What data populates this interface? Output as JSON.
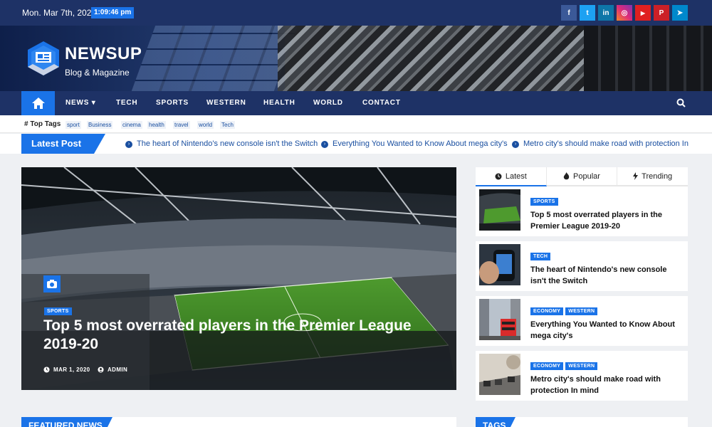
{
  "topbar": {
    "date": "Mon. Mar 7th, 2022",
    "time": "1:09:46 pm",
    "social": [
      {
        "name": "facebook-icon",
        "glyph": "f",
        "color": "#3b5998"
      },
      {
        "name": "twitter-icon",
        "glyph": "t",
        "color": "#1da1f2"
      },
      {
        "name": "linkedin-icon",
        "glyph": "in",
        "color": "#0e76a8"
      },
      {
        "name": "instagram-icon",
        "glyph": "◎",
        "color": "#c13584"
      },
      {
        "name": "youtube-icon",
        "glyph": "▶",
        "color": "#e02020"
      },
      {
        "name": "pinterest-icon",
        "glyph": "P",
        "color": "#cb2027"
      },
      {
        "name": "telegram-icon",
        "glyph": "➤",
        "color": "#0088cc"
      }
    ]
  },
  "header": {
    "brand": "NEWSUP",
    "tagline": "Blog & Magazine"
  },
  "nav": {
    "items": [
      "NEWS",
      "TECH",
      "SPORTS",
      "WESTERN",
      "HEALTH",
      "WORLD",
      "CONTACT"
    ],
    "news_caret": "▾"
  },
  "top_tags": {
    "label": "Top Tags",
    "tags": [
      "sport",
      "Business",
      "cinema",
      "health",
      "travel",
      "world",
      "Tech"
    ]
  },
  "ticker": {
    "label": "Latest Post",
    "items": [
      "The heart of Nintendo's new console isn't the Switch",
      "Everything You Wanted to Know About mega city's",
      "Metro city's should make road with protection In m"
    ]
  },
  "hero": {
    "category": "SPORTS",
    "title": "Top 5 most overrated players in the Premier League 2019-20",
    "date": "MAR 1, 2020",
    "author": "ADMIN"
  },
  "sidebar": {
    "tabs": [
      "Latest",
      "Popular",
      "Trending"
    ],
    "active_tab": "Latest",
    "posts": [
      {
        "categories": [
          "SPORTS"
        ],
        "title": "Top 5 most overrated players in the Premier League 2019-20"
      },
      {
        "categories": [
          "TECH"
        ],
        "title": "The heart of Nintendo's new console isn't the Switch"
      },
      {
        "categories": [
          "ECONOMY",
          "WESTERN"
        ],
        "title": "Everything You Wanted to Know About mega city's"
      },
      {
        "categories": [
          "ECONOMY",
          "WESTERN"
        ],
        "title": "Metro city's should make road with protection In mind"
      }
    ]
  },
  "sections": {
    "featured": "FEATURED NEWS",
    "tags": "TAGS"
  },
  "colors": {
    "navy": "#1e3266",
    "accent": "#1a73e8"
  }
}
